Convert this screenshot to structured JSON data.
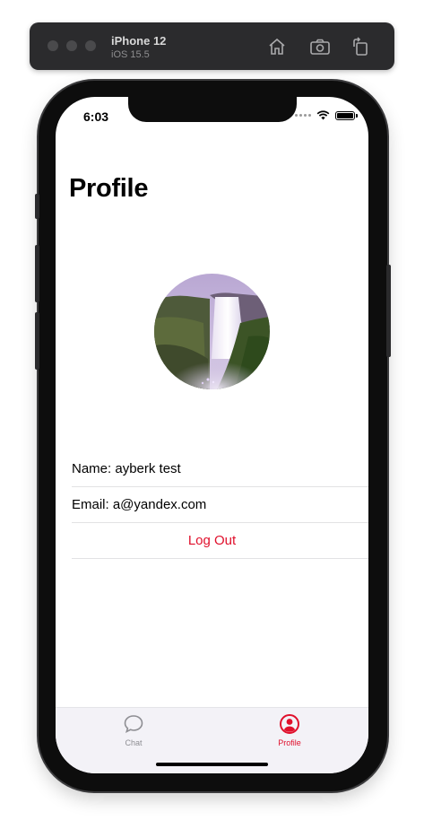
{
  "simulator": {
    "device_name": "iPhone 12",
    "os_version": "iOS 15.5",
    "icons": [
      "home-icon",
      "screenshot-icon",
      "rotate-icon"
    ]
  },
  "status_bar": {
    "time": "6:03",
    "icons": [
      "cellular-dots-icon",
      "wifi-icon",
      "battery-icon"
    ]
  },
  "page": {
    "title": "Profile"
  },
  "profile": {
    "avatar_icon": "waterfall-photo",
    "name_label": "Name: ayberk test",
    "email_label": "Email: a@yandex.com",
    "logout_label": "Log Out"
  },
  "tab_bar": {
    "tabs": [
      {
        "label": "Chat",
        "icon": "chat-bubble-icon",
        "selected": false
      },
      {
        "label": "Profile",
        "icon": "person-circle-icon",
        "selected": true
      }
    ]
  },
  "colors": {
    "accent": "#e0102c",
    "tab_inactive": "#8e8e93",
    "tab_bar_bg": "#f3f2f7"
  }
}
